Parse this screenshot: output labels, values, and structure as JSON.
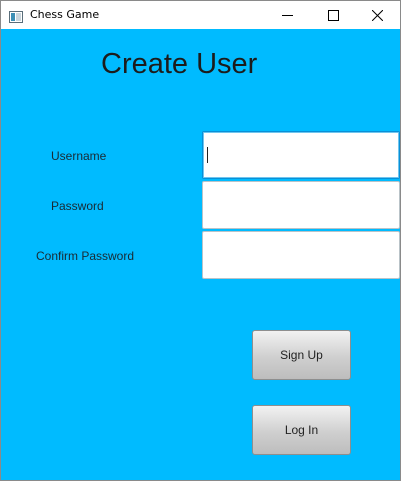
{
  "window": {
    "title": "Chess Game",
    "controls": [
      "minimize-icon",
      "maximize-icon",
      "close-icon"
    ]
  },
  "form": {
    "heading": "Create User",
    "fields": [
      {
        "label": "Username",
        "value": "",
        "focused": true
      },
      {
        "label": "Password",
        "value": ""
      },
      {
        "label": "Confirm Password",
        "value": ""
      }
    ]
  },
  "buttons": {
    "sign_up": "Sign Up",
    "log_in": "Log In"
  },
  "colors": {
    "background": "#00bbff",
    "focus_border": "#0a8fd6",
    "button_face": "#d0d0d0"
  }
}
